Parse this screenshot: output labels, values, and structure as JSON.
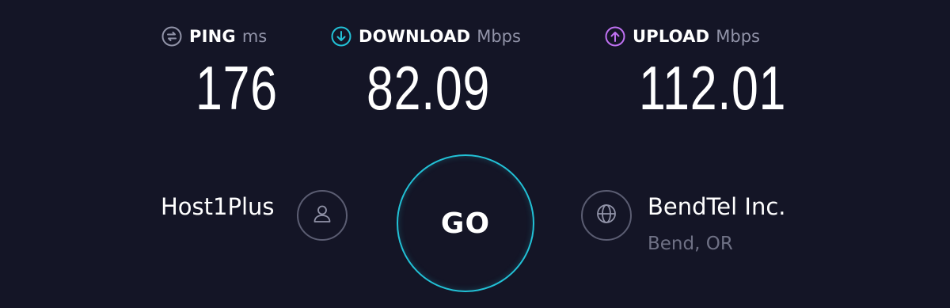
{
  "metrics": {
    "ping": {
      "icon": "ping-icon",
      "label": "PING",
      "unit": "ms",
      "value": "176",
      "color": "#9193a8"
    },
    "download": {
      "icon": "download-icon",
      "label": "DOWNLOAD",
      "unit": "Mbps",
      "value": "82.09",
      "color": "#22c1d6"
    },
    "upload": {
      "icon": "upload-icon",
      "label": "UPLOAD",
      "unit": "Mbps",
      "value": "112.01",
      "color": "#bf71f2"
    }
  },
  "server": {
    "host_name": "Host1Plus",
    "host_icon": "user-icon"
  },
  "go_button": {
    "label": "GO",
    "color": "#22c1d6"
  },
  "isp": {
    "name": "BendTel Inc.",
    "location": "Bend, OR",
    "icon": "globe-icon"
  },
  "colors": {
    "background": "#141526"
  }
}
